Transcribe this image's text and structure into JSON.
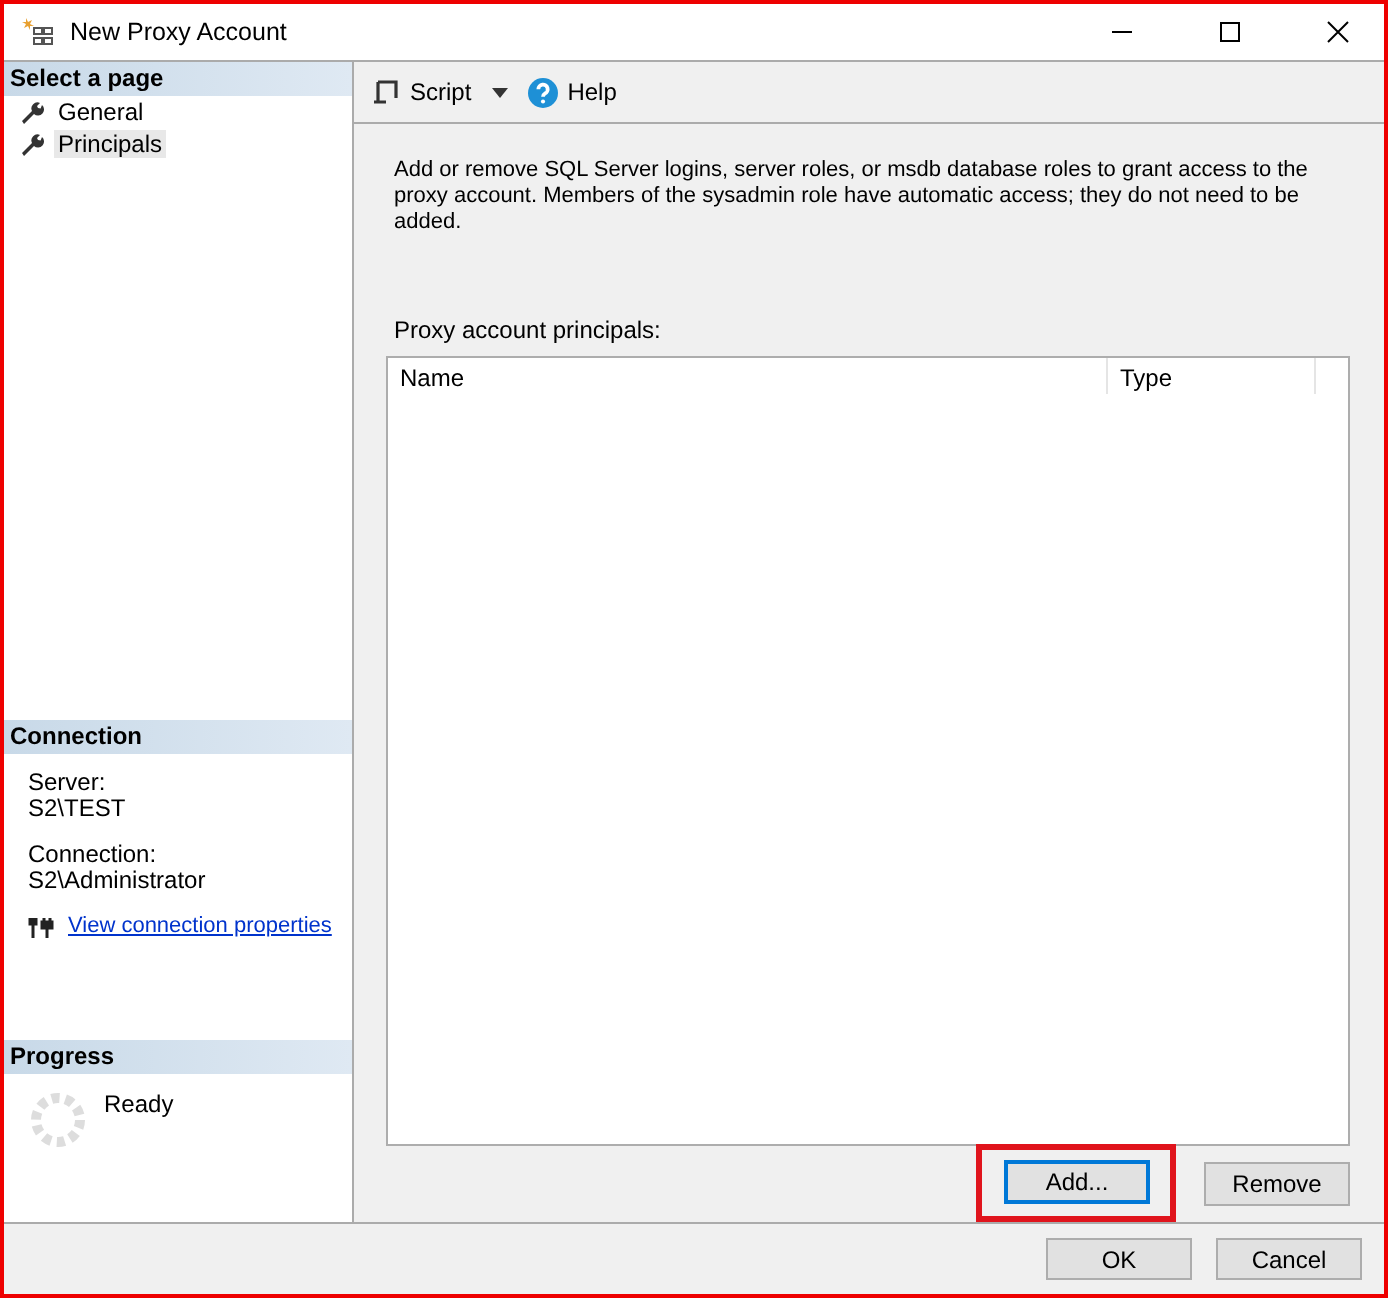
{
  "window": {
    "title": "New Proxy Account"
  },
  "sidebar": {
    "header": "Select a page",
    "pages": [
      {
        "label": "General",
        "selected": false
      },
      {
        "label": "Principals",
        "selected": true
      }
    ]
  },
  "connection": {
    "header": "Connection",
    "server_label": "Server:",
    "server": "S2\\TEST",
    "connection_label": "Connection:",
    "connection": "S2\\Administrator",
    "link": "View connection properties"
  },
  "progress": {
    "header": "Progress",
    "status": "Ready"
  },
  "toolbar": {
    "script": "Script",
    "help": "Help"
  },
  "description": "Add or remove SQL Server logins, server roles, or msdb database roles to grant access to the proxy account. Members of the sysadmin role have automatic access; they do not need to be added.",
  "principals": {
    "label": "Proxy account principals:",
    "columns": [
      "Name",
      "Type"
    ]
  },
  "list_buttons": [
    {
      "label": "Add...",
      "focused": true
    },
    {
      "label": "Remove",
      "focused": false
    }
  ],
  "dialog_buttons": [
    "OK",
    "Cancel"
  ]
}
